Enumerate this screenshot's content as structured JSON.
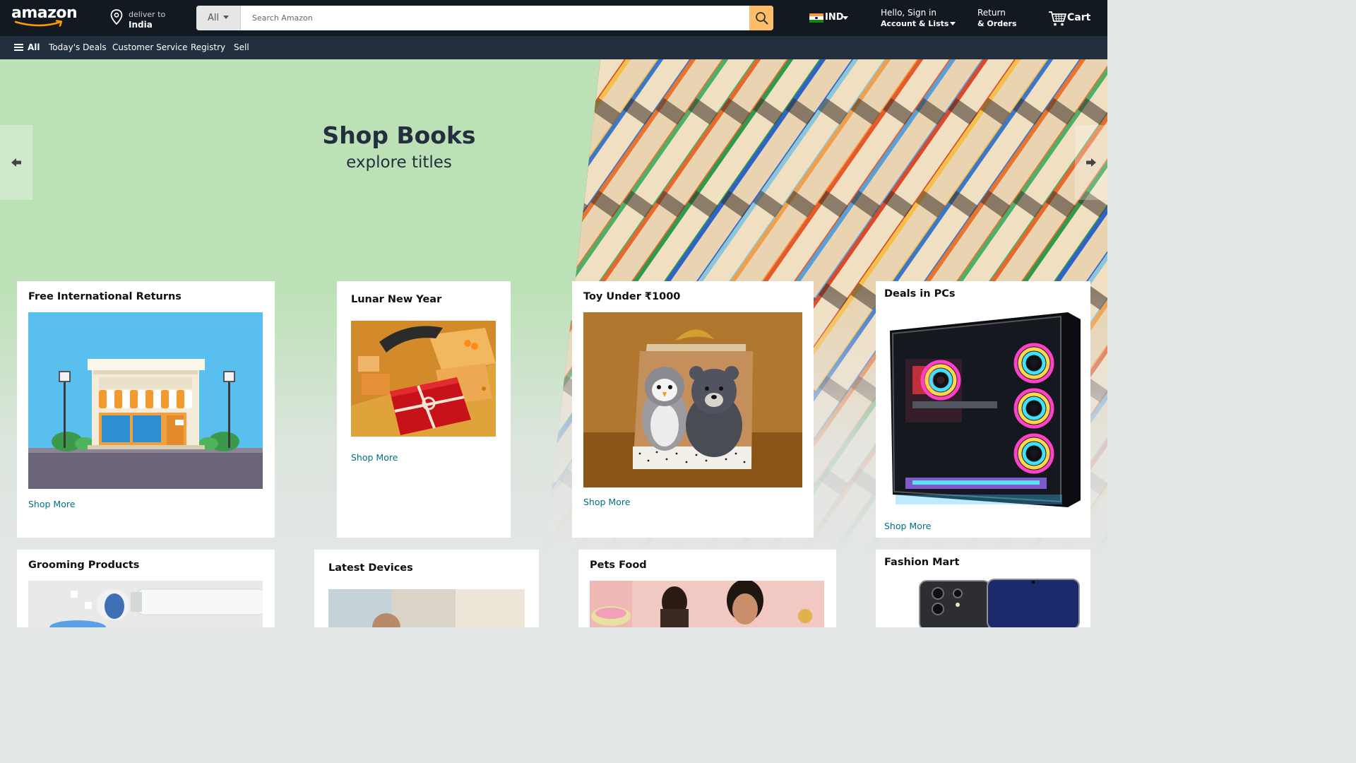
{
  "brand": {
    "logo_text": "amazon"
  },
  "header": {
    "deliver_line1": "deliver to",
    "deliver_line2": "India",
    "search_category": "All",
    "search_placeholder": "Search Amazon",
    "language_code": "IND",
    "account_line1": "Hello, Sign in",
    "account_line2": "Account & Lists",
    "returns_line1": "Return",
    "returns_line2": "& Orders",
    "cart_label": "Cart"
  },
  "subnav": {
    "menu_label": "All",
    "items": [
      "Today's Deals",
      "Customer Service",
      "Registry",
      "Sell"
    ]
  },
  "hero": {
    "title": "Shop Books",
    "subtitle": "explore titles"
  },
  "cards": [
    {
      "title": "Free International Returns",
      "link": "Shop More"
    },
    {
      "title": "Lunar New Year",
      "link": "Shop More"
    },
    {
      "title": "Toy Under ₹1000",
      "link": "Shop More"
    },
    {
      "title": "Deals in PCs",
      "link": "Shop More"
    },
    {
      "title": "Grooming Products"
    },
    {
      "title": "Latest Devices"
    },
    {
      "title": "Pets Food"
    },
    {
      "title": "Fashion Mart"
    }
  ],
  "colors": {
    "nav_dark": "#131921",
    "nav_secondary": "#232f3e",
    "search_button": "#febd69",
    "hero_green": "#bde1b7",
    "link": "#007185",
    "page_bg": "#e3e6e6"
  },
  "icons": [
    "amazon-smile-icon",
    "location-pin-icon",
    "search-icon",
    "india-flag-icon",
    "cart-icon",
    "hamburger-icon",
    "arrow-left-icon",
    "arrow-right-icon"
  ]
}
